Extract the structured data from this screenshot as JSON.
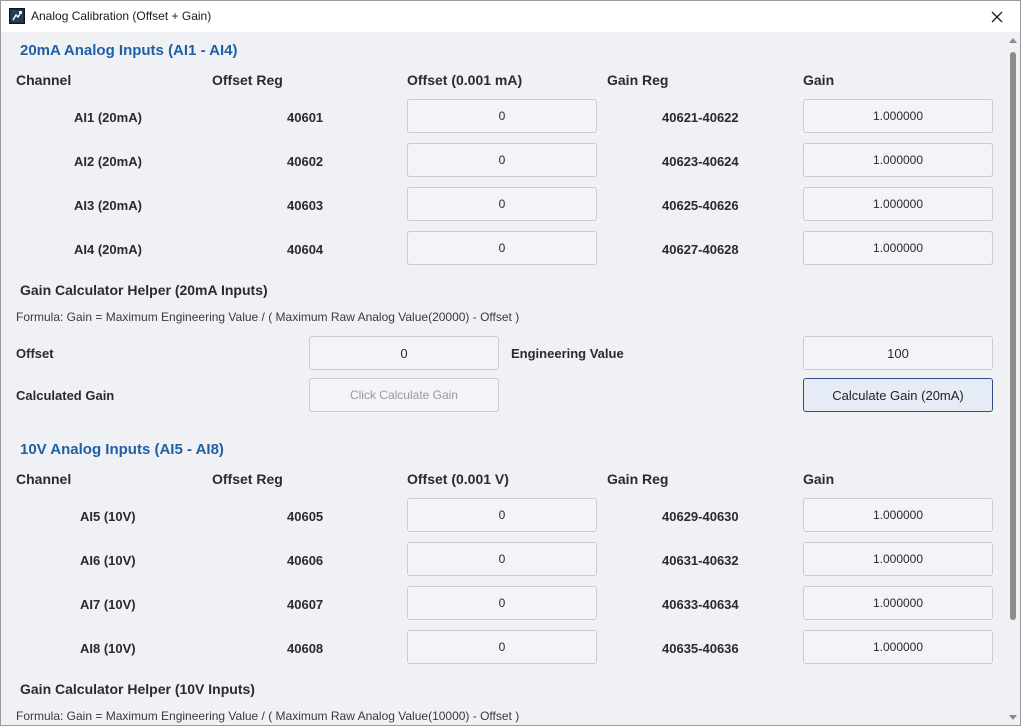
{
  "window": {
    "title": "Analog Calibration (Offset + Gain)"
  },
  "section_20ma": {
    "title": "20mA Analog Inputs (AI1 - AI4)",
    "headers": {
      "channel": "Channel",
      "offset_reg": "Offset Reg",
      "offset": "Offset (0.001 mA)",
      "gain_reg": "Gain Reg",
      "gain": "Gain"
    },
    "rows": [
      {
        "channel": "AI1 (20mA)",
        "offset_reg": "40601",
        "offset": "0",
        "gain_reg": "40621-40622",
        "gain": "1.000000"
      },
      {
        "channel": "AI2 (20mA)",
        "offset_reg": "40602",
        "offset": "0",
        "gain_reg": "40623-40624",
        "gain": "1.000000"
      },
      {
        "channel": "AI3 (20mA)",
        "offset_reg": "40603",
        "offset": "0",
        "gain_reg": "40625-40626",
        "gain": "1.000000"
      },
      {
        "channel": "AI4 (20mA)",
        "offset_reg": "40604",
        "offset": "0",
        "gain_reg": "40627-40628",
        "gain": "1.000000"
      }
    ],
    "helper": {
      "title": "Gain Calculator Helper (20mA Inputs)",
      "formula": "Formula: Gain = Maximum Engineering Value / ( Maximum Raw Analog Value(20000) - Offset )",
      "offset_label": "Offset",
      "offset_value": "0",
      "eng_label": "Engineering Value",
      "eng_value": "100",
      "calc_label": "Calculated Gain",
      "calc_result": "Click Calculate Gain",
      "calc_button": "Calculate Gain (20mA)"
    }
  },
  "section_10v": {
    "title": "10V Analog Inputs (AI5 - AI8)",
    "headers": {
      "channel": "Channel",
      "offset_reg": "Offset Reg",
      "offset": "Offset (0.001 V)",
      "gain_reg": "Gain Reg",
      "gain": "Gain"
    },
    "rows": [
      {
        "channel": "AI5 (10V)",
        "offset_reg": "40605",
        "offset": "0",
        "gain_reg": "40629-40630",
        "gain": "1.000000"
      },
      {
        "channel": "AI6 (10V)",
        "offset_reg": "40606",
        "offset": "0",
        "gain_reg": "40631-40632",
        "gain": "1.000000"
      },
      {
        "channel": "AI7 (10V)",
        "offset_reg": "40607",
        "offset": "0",
        "gain_reg": "40633-40634",
        "gain": "1.000000"
      },
      {
        "channel": "AI8 (10V)",
        "offset_reg": "40608",
        "offset": "0",
        "gain_reg": "40635-40636",
        "gain": "1.000000"
      }
    ],
    "helper": {
      "title": "Gain Calculator Helper (10V Inputs)",
      "formula": "Formula: Gain = Maximum Engineering Value / ( Maximum Raw Analog Value(10000) - Offset )"
    }
  },
  "colors": {
    "accent": "#1f5fa6",
    "background": "#f0f1f5",
    "field_border": "#c9ccd2",
    "primary_button_border": "#2d4f86"
  }
}
